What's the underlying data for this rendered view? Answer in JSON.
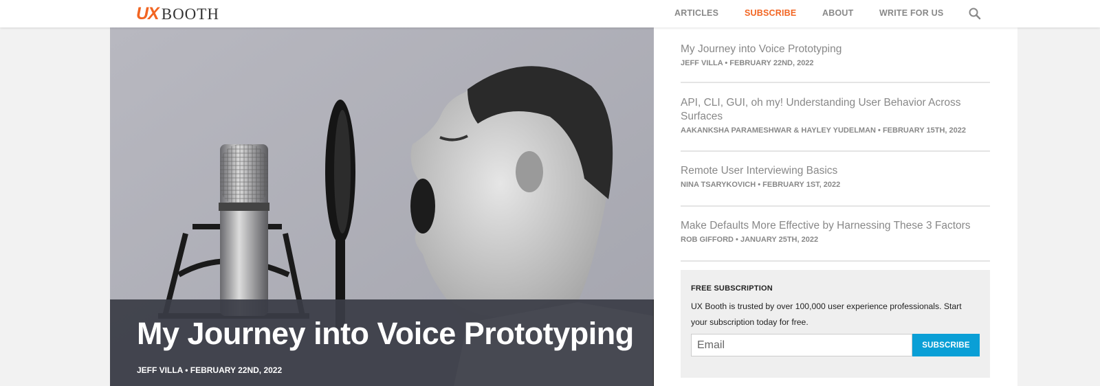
{
  "header": {
    "logo": {
      "ux": "UX",
      "booth": "BOOTH"
    },
    "nav": [
      {
        "label": "ARTICLES"
      },
      {
        "label": "SUBSCRIBE"
      },
      {
        "label": "ABOUT"
      },
      {
        "label": "WRITE FOR US"
      }
    ]
  },
  "hero": {
    "title": "My Journey into Voice Prototyping",
    "meta": "JEFF VILLA • FEBRUARY 22ND, 2022"
  },
  "sidebar": {
    "articles": [
      {
        "title": "My Journey into Voice Prototyping",
        "meta": "JEFF VILLA • FEBRUARY 22ND, 2022"
      },
      {
        "title": "API, CLI, GUI, oh my! Understanding User Behavior Across Surfaces",
        "meta": "AAKANKSHA PARAMESHWAR & HAYLEY YUDELMAN • FEBRUARY 15TH, 2022"
      },
      {
        "title": "Remote User Interviewing Basics",
        "meta": "NINA TSARYKOVICH • FEBRUARY 1ST, 2022"
      },
      {
        "title": "Make Defaults More Effective by Harnessing These 3 Factors",
        "meta": "ROB GIFFORD • JANUARY 25TH, 2022"
      }
    ]
  },
  "subscription": {
    "heading": "FREE SUBSCRIPTION",
    "text": "UX Booth is trusted by over 100,000 user experience professionals. Start your subscription today for free.",
    "email_placeholder": "Email",
    "button_label": "SUBSCRIBE"
  },
  "colors": {
    "accent": "#f26522",
    "button": "#0a9fd6"
  },
  "icons": {
    "search": "search-icon"
  }
}
